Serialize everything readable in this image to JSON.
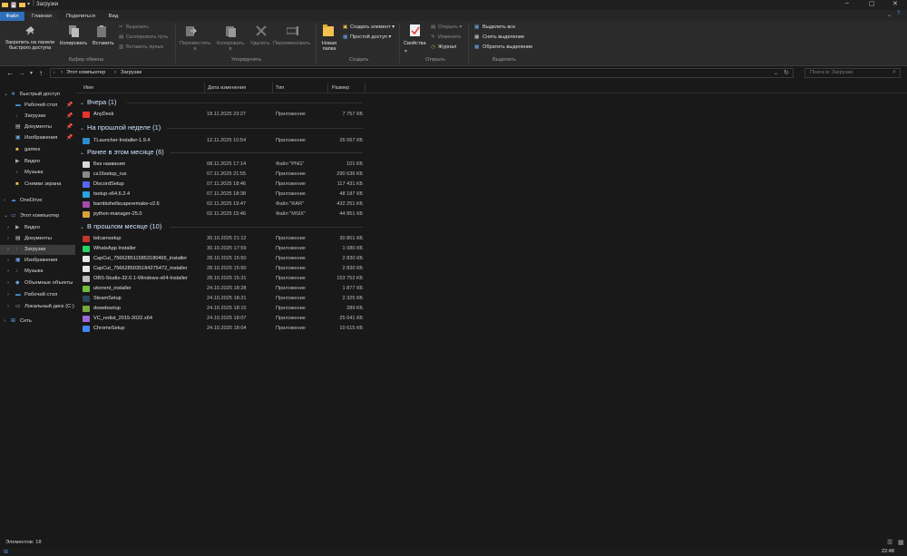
{
  "window": {
    "title": "Загрузки"
  },
  "file_tabs": [
    {
      "label": "Файл"
    },
    {
      "label": "Главная"
    },
    {
      "label": "Поделиться"
    },
    {
      "label": "Вид"
    }
  ],
  "ribbon": {
    "pin": "Закрепить на панели\nбыстрого доступа",
    "copy": "Копировать",
    "paste": "Вставить",
    "cut": "Вырезать",
    "copy_path": "Скопировать путь",
    "paste_shortcut": "Вставить ярлык",
    "group_clipboard": "Буфер обмена",
    "move": "Переместить\nв",
    "copy_to": "Копировать\nв",
    "delete": "Удалить",
    "rename": "Переименовать",
    "group_organize": "Упорядочить",
    "new_folder": "Новая\nпапка",
    "new_item": "Создать элемент",
    "easy_access": "Простой доступ",
    "group_create": "Создать",
    "properties": "Свойства",
    "open": "Открыть",
    "edit": "Изменить",
    "history": "Журнал",
    "group_open": "Открыть",
    "select_all": "Выделить все",
    "select_none": "Снять выделение",
    "invert_selection": "Обратить выделение",
    "group_select": "Выделить"
  },
  "address": {
    "crumbs": [
      "Этот компьютер",
      "Загрузки"
    ],
    "search_placeholder": "Поиск в: Загрузки"
  },
  "nav": {
    "quick_access": "Быстрый доступ",
    "quick_items": [
      {
        "label": "Рабочий стол",
        "pinned": true
      },
      {
        "label": "Загрузки",
        "pinned": true
      },
      {
        "label": "Документы",
        "pinned": true
      },
      {
        "label": "Изображения",
        "pinned": true
      },
      {
        "label": "games",
        "pinned": false
      },
      {
        "label": "Видео",
        "pinned": false
      },
      {
        "label": "Музыка",
        "pinned": false
      },
      {
        "label": "Снимки экрана",
        "pinned": false
      }
    ],
    "onedrive": "OneDrive",
    "this_pc": "Этот компьютер",
    "pc_items": [
      {
        "label": "Видео"
      },
      {
        "label": "Документы"
      },
      {
        "label": "Загрузки"
      },
      {
        "label": "Изображения"
      },
      {
        "label": "Музыка"
      },
      {
        "label": "Объемные объекты"
      },
      {
        "label": "Рабочий стол"
      },
      {
        "label": "Локальный диск (C:)"
      }
    ],
    "network": "Сеть"
  },
  "columns": {
    "name": "Имя",
    "date": "Дата изменения",
    "type": "Тип",
    "size": "Размер"
  },
  "groups": [
    {
      "title": "Вчера (1)",
      "files": [
        {
          "name": "AnyDesk",
          "date": "18.11.2025 23:27",
          "type": "Приложение",
          "size": "7 757 КБ",
          "color": "#e8352b"
        }
      ]
    },
    {
      "title": "На прошлой неделе (1)",
      "files": [
        {
          "name": "TLauncher-Installer-1.9.4",
          "date": "12.11.2025 10:54",
          "type": "Приложение",
          "size": "26 067 КБ",
          "color": "#2f8cc9"
        }
      ]
    },
    {
      "title": "Ранее в этом месяце (6)",
      "files": [
        {
          "name": "Без названия",
          "date": "08.11.2025 17:14",
          "type": "Файл \"PNG\"",
          "size": "101 КБ",
          "color": "#d9d9d9"
        },
        {
          "name": "cs16setup_rus",
          "date": "07.11.2025 21:55",
          "type": "Приложение",
          "size": "290 636 КБ",
          "color": "#8a8a8a"
        },
        {
          "name": "DiscordSetup",
          "date": "07.11.2025 18:46",
          "type": "Приложение",
          "size": "117 431 КБ",
          "color": "#5865f2"
        },
        {
          "name": "tsetup-x64.6.2.4",
          "date": "07.11.2025 18:38",
          "type": "Приложение",
          "size": "48 187 КБ",
          "color": "#2aa3e0"
        },
        {
          "name": "bambishellscaperemake-v2.6",
          "date": "02.11.2025 19:47",
          "type": "Файл \"RAR\"",
          "size": "432 251 КБ",
          "color": "#a64ca6"
        },
        {
          "name": "python-manager-25.0",
          "date": "02.11.2025 15:46",
          "type": "Файл \"MSIX\"",
          "size": "44 851 КБ",
          "color": "#d8a23a"
        }
      ]
    },
    {
      "title": "В прошлом месяце (10)",
      "files": [
        {
          "name": "bdcamsetup",
          "date": "30.10.2025 21:12",
          "type": "Приложение",
          "size": "30 801 КБ",
          "color": "#c0392b"
        },
        {
          "name": "WhatsApp Installer",
          "date": "30.10.2025 17:59",
          "type": "Приложение",
          "size": "1 080 КБ",
          "color": "#25d366"
        },
        {
          "name": "CapCut_7566285115853180465_installer",
          "date": "28.10.2025 15:50",
          "type": "Приложение",
          "size": "2 830 КБ",
          "color": "#e6e6e6"
        },
        {
          "name": "CapCut_7566285035184275472_installer",
          "date": "28.10.2025 15:50",
          "type": "Приложение",
          "size": "2 830 КБ",
          "color": "#e6e6e6"
        },
        {
          "name": "OBS-Studio-32.0.1-Windows-x64-Installer",
          "date": "28.10.2025 15:31",
          "type": "Приложение",
          "size": "153 752 КБ",
          "color": "#bbbbbb"
        },
        {
          "name": "utorrent_installer",
          "date": "24.10.2025 18:28",
          "type": "Приложение",
          "size": "1 877 КБ",
          "color": "#6fbf3a"
        },
        {
          "name": "SteamSetup",
          "date": "24.10.2025 18:21",
          "type": "Приложение",
          "size": "2 325 КБ",
          "color": "#2a475e"
        },
        {
          "name": "dxwebsetup",
          "date": "24.10.2025 18:15",
          "type": "Приложение",
          "size": "289 КБ",
          "color": "#7aa83a"
        },
        {
          "name": "VC_redist_2015-2022.x64",
          "date": "24.10.2025 18:07",
          "type": "Приложение",
          "size": "25 041 КБ",
          "color": "#9c6bd6"
        },
        {
          "name": "ChromeSetup",
          "date": "24.10.2025 18:04",
          "type": "Приложение",
          "size": "10 615 КБ",
          "color": "#4285f4"
        }
      ]
    }
  ],
  "status": {
    "items": "Элементов: 18"
  },
  "taskbar": {
    "time": "22:48"
  }
}
